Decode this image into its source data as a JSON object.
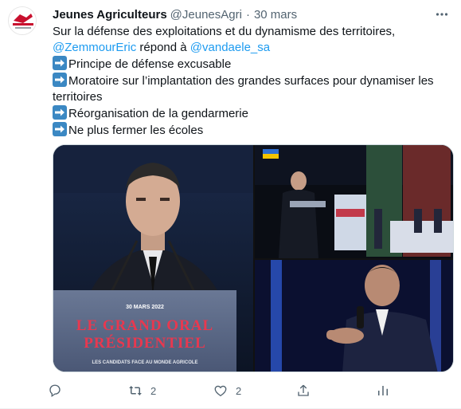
{
  "tweet": {
    "author_name": "Jeunes Agriculteurs",
    "author_handle": "@JeunesAgri",
    "separator": "·",
    "time": "30 mars",
    "text_line1": "Sur la défense des exploitations et du dynamisme des territoires,",
    "mention1": "@ZemmourEric",
    "text_mid": " répond à ",
    "mention2": "@vandaele_sa",
    "bullets": [
      "Principe de défense excusable",
      "Moratoire sur l’implantation des grandes surfaces pour dynamiser les",
      "territoires",
      "Réorganisation de la gendarmerie",
      "Ne plus fermer les écoles"
    ]
  },
  "media": {
    "banner_date": "30 MARS 2022",
    "banner_title_1": "LE GRAND ORAL",
    "banner_title_2": "PRÉSIDENTIEL",
    "banner_subtitle": "LES CANDIDATS FACE AU MONDE AGRICOLE"
  },
  "actions": {
    "reply_icon": "reply-icon",
    "retweet_count": "2",
    "like_count": "2"
  },
  "colors": {
    "accent": "#1d9bf0",
    "muted": "#536471",
    "arrow_emoji": "#3b88c3",
    "banner_red": "#e8384f"
  }
}
